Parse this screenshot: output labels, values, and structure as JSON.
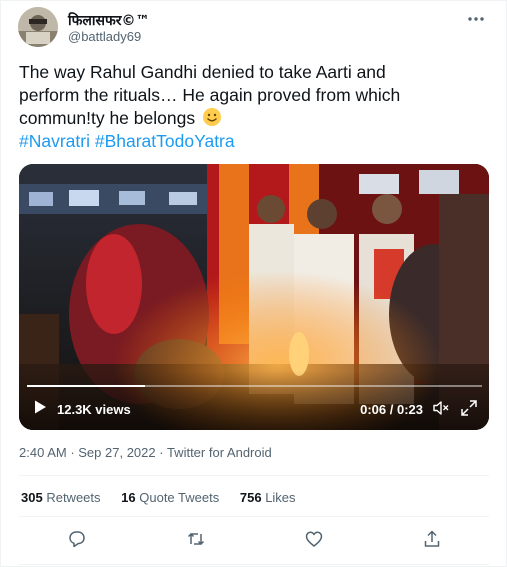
{
  "tweet": {
    "author": {
      "display_name": "फिलासफर©™",
      "handle": "@battlady69"
    },
    "text_line1": "The way Rahul Gandhi denied to take Aarti and",
    "text_line2": "perform the rituals… He again proved from which",
    "text_line3": "commun!ty he belongs",
    "hashtags": "#Navratri #BharatTodoYatra",
    "video": {
      "views": "12.3K views",
      "timecode": "0:06 / 0:23",
      "progress": 0.26
    },
    "meta": {
      "time": "2:40 AM",
      "sep1": " · ",
      "date": "Sep 27, 2022",
      "sep2": " · ",
      "source": "Twitter for Android"
    },
    "stats": {
      "retweets_count": "305",
      "retweets_label": "Retweets",
      "quotes_count": "16",
      "quotes_label": "Quote Tweets",
      "likes_count": "756",
      "likes_label": "Likes"
    },
    "icons": [
      "more-icon",
      "emoji-smile-icon",
      "play-icon",
      "mute-icon",
      "expand-icon",
      "reply-icon",
      "retweet-icon",
      "like-icon",
      "share-icon"
    ],
    "colors": {
      "link": "#1d9bf0",
      "secondary_text": "#536471",
      "primary_text": "#0f1419",
      "divider": "#eff3f4"
    }
  }
}
